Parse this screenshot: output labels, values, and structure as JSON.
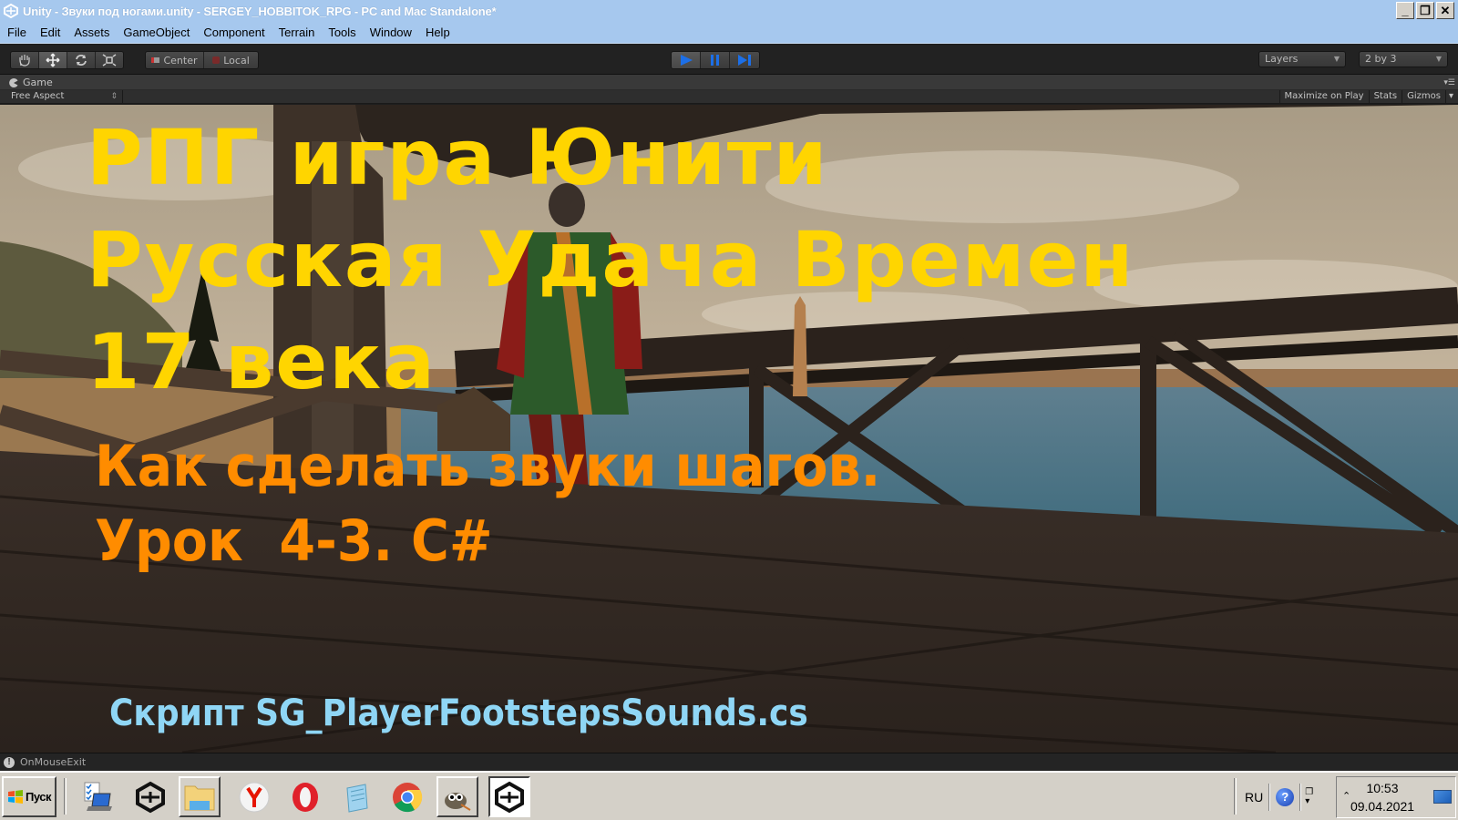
{
  "window": {
    "title": "Unity - Звуки под ногами.unity - SERGEY_HOBBITOK_RPG - PC and Mac Standalone*",
    "controls": {
      "minimize": "_",
      "restore": "❐",
      "close": "✕"
    }
  },
  "menubar": {
    "items": [
      "File",
      "Edit",
      "Assets",
      "GameObject",
      "Component",
      "Terrain",
      "Tools",
      "Window",
      "Help"
    ]
  },
  "toolbar": {
    "transform_tools": [
      "hand-tool",
      "move-tool",
      "rotate-tool",
      "scale-tool"
    ],
    "active_tool": "move-tool",
    "pivot_mode": "Center",
    "pivot_rotation": "Local",
    "play_state": {
      "play": true,
      "pause": false,
      "step": false
    },
    "layers_label": "Layers",
    "layout_label": "2 by 3"
  },
  "game_view": {
    "tab_label": "Game",
    "aspect": "Free Aspect",
    "buttons": [
      "Maximize on Play",
      "Stats",
      "Gizmos"
    ]
  },
  "overlay": {
    "title_lines": [
      "РПГ игра Юнити",
      "Русская Удача Времен",
      "17 века"
    ],
    "subtitle_lines": [
      "Как сделать звуки шагов.",
      "Урок  4-3. C#"
    ],
    "script_line": "Скрипт SG_PlayerFootstepsSounds.cs",
    "colors": {
      "title": "#ffd500",
      "subtitle": "#ff8c00",
      "script": "#8fd6f5"
    }
  },
  "statusbar": {
    "message": "OnMouseExit"
  },
  "taskbar": {
    "start_label": "Пуск",
    "apps": [
      "task-manager",
      "unity",
      "explorer",
      "yandex-browser",
      "opera",
      "notepad",
      "chrome",
      "gimp",
      "unity-active"
    ],
    "tray": {
      "language": "RU",
      "time": "10:53",
      "date": "09.04.2021"
    }
  }
}
